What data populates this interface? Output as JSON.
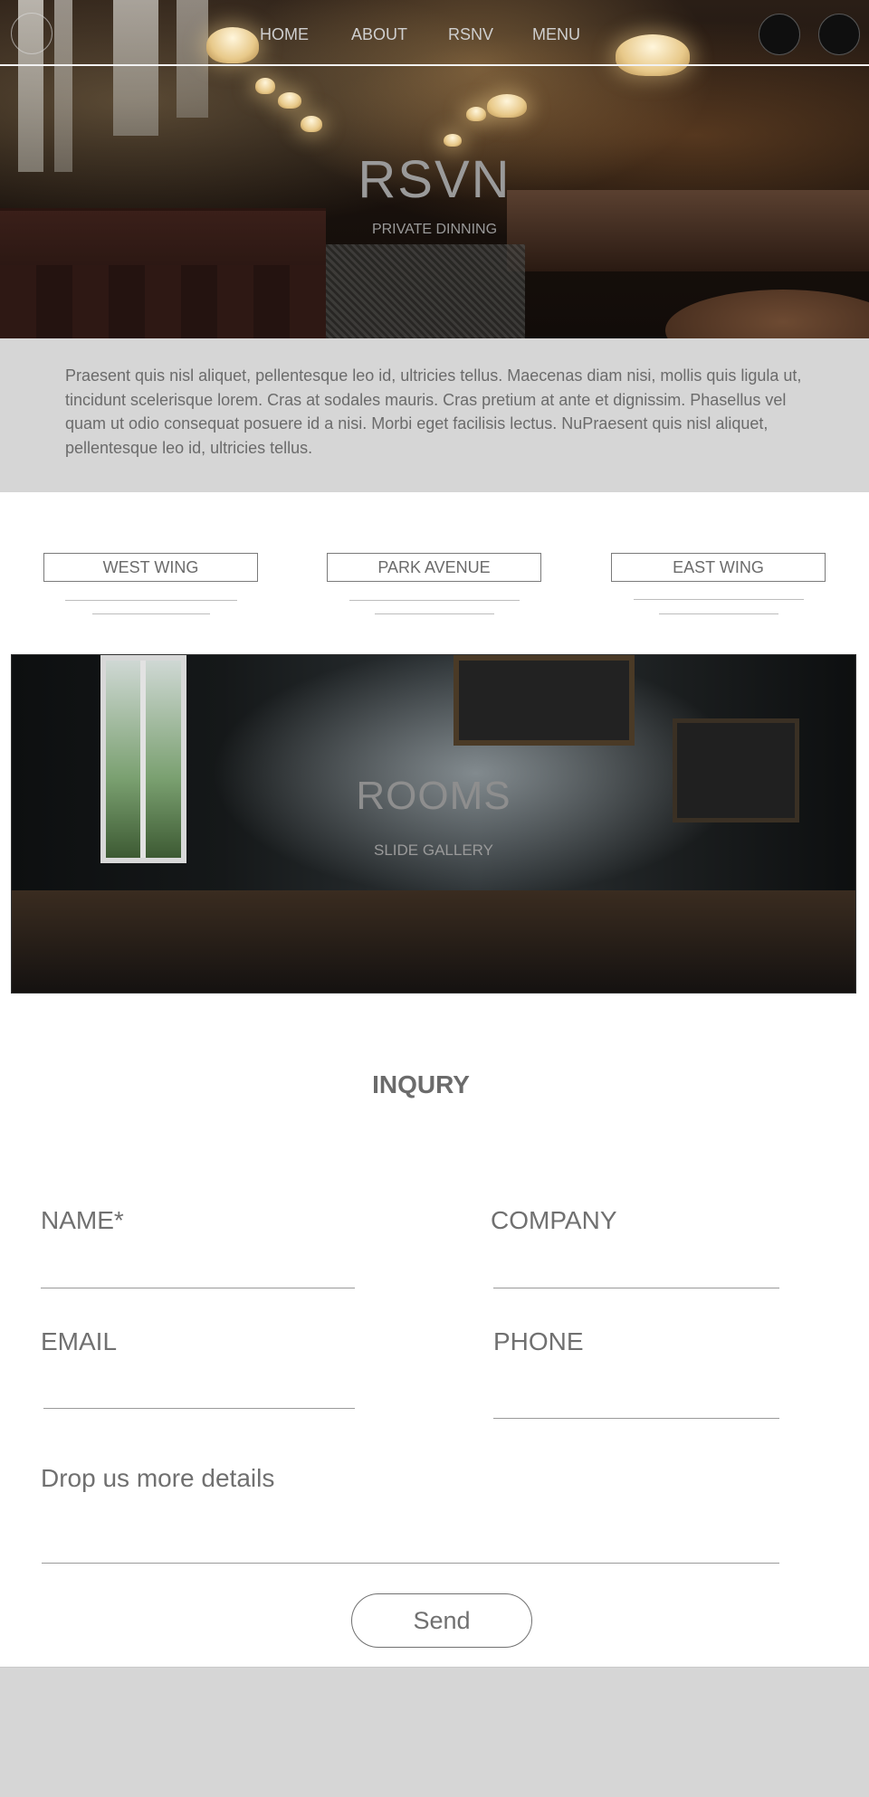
{
  "nav": {
    "items": [
      "HOME",
      "ABOUT",
      "RSNV",
      "MENU"
    ]
  },
  "hero": {
    "title": "RSVN",
    "subtitle": "PRIVATE DINNING"
  },
  "intro": {
    "text": "Praesent quis nisl aliquet, pellentesque leo id, ultricies tellus. Maecenas diam nisi, mollis quis ligula ut, tincidunt scelerisque lorem. Cras at sodales mauris. Cras pretium at ante et dignissim. Phasellus vel quam ut odio consequat posuere id a nisi. Morbi eget facilisis lectus. NuPraesent quis nisl aliquet, pellentesque leo id, ultricies tellus."
  },
  "wings": [
    "WEST WING",
    "PARK AVENUE",
    "EAST WING"
  ],
  "rooms": {
    "title": "ROOMS",
    "subtitle": "SLIDE GALLERY"
  },
  "inquiry": {
    "title": "INQURY",
    "name_label": "NAME*",
    "company_label": "COMPANY",
    "email_label": "EMAIL",
    "phone_label": "PHONE",
    "details_label": "Drop us more details",
    "send_label": "Send"
  }
}
